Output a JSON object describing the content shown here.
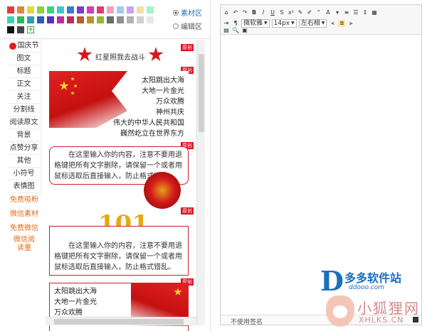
{
  "palette": {
    "row1": [
      "#e23b3b",
      "#e2883b",
      "#e2d83b",
      "#8ad33b",
      "#3bd37a",
      "#3bc9d3",
      "#3b7ad3",
      "#7a3bd3",
      "#d33bb8",
      "#e23b6e",
      "#f3a3b5",
      "#a3c9f3",
      "#c9a3f3",
      "#f3e0a3",
      "#a3f3c4"
    ],
    "row2": [
      "#3bd3b3",
      "#2fb85c",
      "#2f9bb8",
      "#2f5cb8",
      "#5c2fb8",
      "#b82f9b",
      "#b82f5c",
      "#b85c2f",
      "#b8932f",
      "#93b82f",
      "#6b6b6b",
      "#8f8f8f",
      "#b3b3b3",
      "#d0d0d0",
      "#e8e8e8"
    ],
    "row3": [
      "#111111",
      "#444444"
    ],
    "add_label": "+"
  },
  "source_options": [
    {
      "label": "素材区",
      "selected": true
    },
    {
      "label": "编辑区",
      "selected": false
    }
  ],
  "categories": [
    "国庆节",
    "图文",
    "标题",
    "正文",
    "关注",
    "分割线",
    "阅读原文",
    "背景",
    "点赞分享",
    "其他",
    "小符号",
    "表情图"
  ],
  "promo_links": [
    "免费吸粉",
    "微信素材",
    "免费微信",
    "微信阅读量"
  ],
  "templates": {
    "tag": "原创",
    "card1_title": "红星照我去战斗",
    "poem_lines": [
      "太阳跳出大海",
      "大地一片金光",
      "万众欢腾",
      "神州共庆",
      "伟大的中华人民共和国",
      "巍然屹立在世界东方"
    ],
    "body_text": "在这里输入你的内容，注意不要用退格键把所有文字删除，请保留一个或者用鼠标选取后直接输入，防止格式错乱。",
    "body_text_short": "在这里输入你的内容，注意不要用退格键把所有文字删除，请保留一个或者用鼠标选取后直接输入，防止格式错乱。",
    "badge_digits": "101",
    "poem_bottom": [
      "太阳跳出大海",
      "大地一片金光",
      "万众欢腾"
    ]
  },
  "editor": {
    "font_family": "微软雅",
    "font_size": "14px",
    "align": "左右相",
    "status_text": "不使用签名"
  },
  "watermarks": {
    "logo1_name": "多多软件站",
    "logo1_url": "ddooo.com",
    "logo2_name": "小狐狸网",
    "logo2_domain": "XHLKS.CN"
  }
}
